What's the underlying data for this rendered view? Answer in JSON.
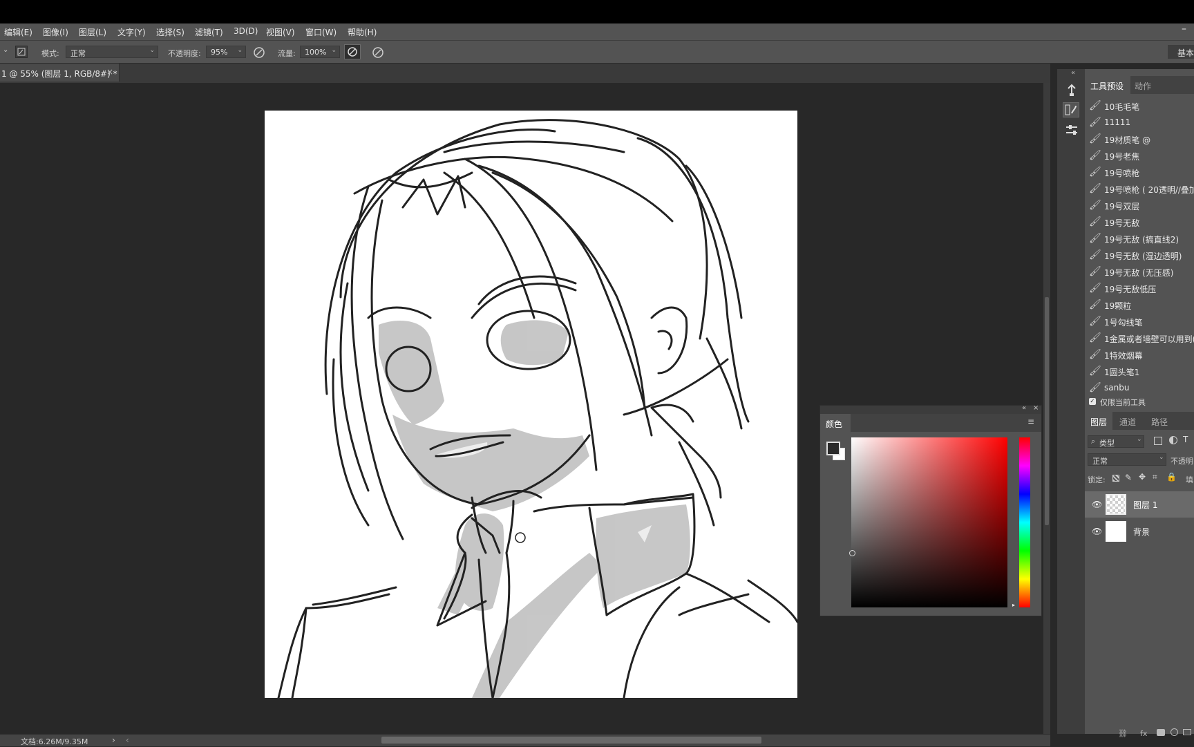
{
  "menu": [
    "编辑(E)",
    "图像(I)",
    "图层(L)",
    "文字(Y)",
    "选择(S)",
    "滤镜(T)",
    "3D(D)",
    "视图(V)",
    "窗口(W)",
    "帮助(H)"
  ],
  "options": {
    "mode_label": "模式:",
    "mode_value": "正常",
    "opacity_label": "不透明度:",
    "opacity_value": "95%",
    "flow_label": "流量:",
    "flow_value": "100%",
    "workspace_label": "基本"
  },
  "document": {
    "tab_title": "1 @ 55% (图层 1, RGB/8#) *",
    "close": "×",
    "status": "文档:6.26M/9.35M"
  },
  "presets_panel": {
    "tabs": [
      "工具预设",
      "动作"
    ],
    "items": [
      "10毛毛笔",
      "11111",
      "19材质笔 @",
      "19号老焦",
      "19号喷枪",
      "19号喷枪 ( 20透明//叠加",
      "19号双层",
      "19号无敌",
      "19号无敌 (搞直线2)",
      "19号无敌 (湿边透明)",
      "19号无敌 (无压感)",
      "19号无敌低压",
      "19颗粒",
      "1号勾线笔",
      "1金属或者墙壁可以用到(",
      "1特效烟幕",
      "1圆头笔1",
      "sanbu"
    ],
    "current_only_label": "仅限当前工具"
  },
  "color_panel": {
    "title": "颜色",
    "foreground_color": "#2a2a2a",
    "background_color": "#ffffff",
    "hue_color": "#ff0000"
  },
  "layers_panel": {
    "tabs": [
      "图层",
      "通道",
      "路径"
    ],
    "filter_label": "类型",
    "blend_mode": "正常",
    "opacity_label": "不透明",
    "lock_label": "锁定:",
    "fill_label": "填",
    "layers": [
      {
        "name": "图层 1",
        "selected": true
      },
      {
        "name": "背景",
        "selected": false
      }
    ],
    "footer_fx": "fx"
  }
}
